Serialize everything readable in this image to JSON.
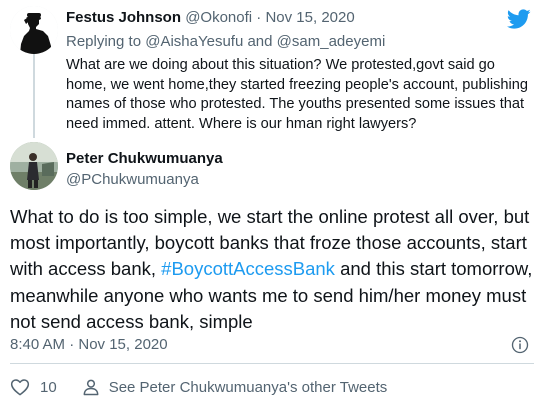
{
  "parent_tweet": {
    "name": "Festus Johnson",
    "handle": "@Okonofi",
    "separator": " · ",
    "date": "Nov 15, 2020",
    "replying_prefix": "Replying to ",
    "mention1": "@AishaYesufu",
    "and_text": " and ",
    "mention2": "@sam_adeyemi",
    "text": "What are we doing about this situation? We protested,govt said go home, we went home,they started freezing people's account, publishing names of those who protested. The youths presented some issues that need immed. attent. Where is our hman right lawyers?"
  },
  "main_tweet": {
    "name": "Peter Chukwumuanya",
    "handle": "@PChukwumuanya",
    "text_before": "What to do is too simple, we start the online protest all over, but most importantly, boycott banks that froze those accounts, start with access bank, ",
    "hashtag": "#BoycottAccessBank",
    "text_after": " and this start tomorrow, meanwhile anyone who wants me to send him/her money must not send access bank, simple",
    "timestamp": "8:40 AM · Nov 15, 2020"
  },
  "actions": {
    "like_count": "10",
    "other_tweets": "See Peter Chukwumuanya's other Tweets"
  },
  "icons": {
    "logo": "twitter-bird-icon",
    "info": "info-icon",
    "like": "heart-icon",
    "profile": "person-icon"
  },
  "colors": {
    "twitter_blue": "#1d9bf0",
    "secondary_text": "#536471",
    "divider": "#cfd9de"
  }
}
